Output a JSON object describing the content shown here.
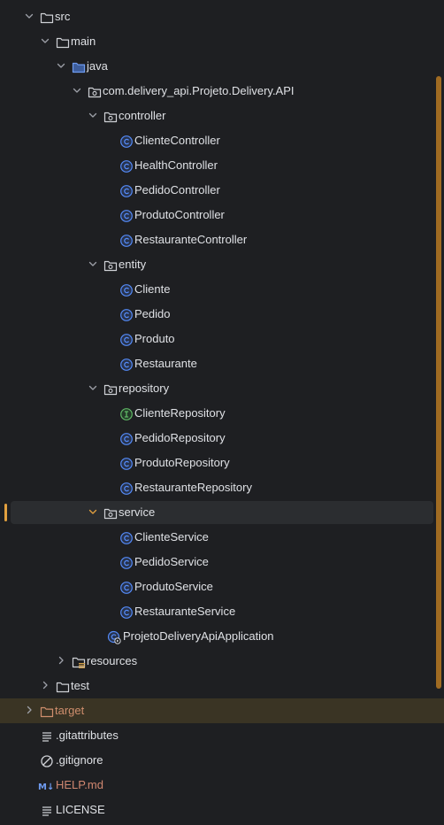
{
  "tree": [
    {
      "label": "src",
      "kind": "folder",
      "level": 0,
      "expanded": true,
      "name": "tree-node-src"
    },
    {
      "label": "main",
      "kind": "folder",
      "level": 1,
      "expanded": true,
      "name": "tree-node-main"
    },
    {
      "label": "java",
      "kind": "folder-source",
      "level": 2,
      "expanded": true,
      "name": "tree-node-java"
    },
    {
      "label": "com.delivery_api.Projeto.Delivery.API",
      "kind": "package",
      "level": 3,
      "expanded": true,
      "name": "tree-node-root-package"
    },
    {
      "label": "controller",
      "kind": "package",
      "level": 4,
      "expanded": true,
      "name": "tree-node-controller"
    },
    {
      "label": "ClienteController",
      "kind": "class",
      "level": 5,
      "name": "tree-node-clientecontroller"
    },
    {
      "label": "HealthController",
      "kind": "class",
      "level": 5,
      "name": "tree-node-healthcontroller"
    },
    {
      "label": "PedidoController",
      "kind": "class",
      "level": 5,
      "name": "tree-node-pedidocontroller"
    },
    {
      "label": "ProdutoController",
      "kind": "class",
      "level": 5,
      "name": "tree-node-produtocontroller"
    },
    {
      "label": "RestauranteController",
      "kind": "class",
      "level": 5,
      "name": "tree-node-restaurantecontroller"
    },
    {
      "label": "entity",
      "kind": "package",
      "level": 4,
      "expanded": true,
      "name": "tree-node-entity"
    },
    {
      "label": "Cliente",
      "kind": "class",
      "level": 5,
      "name": "tree-node-cliente"
    },
    {
      "label": "Pedido",
      "kind": "class",
      "level": 5,
      "name": "tree-node-pedido"
    },
    {
      "label": "Produto",
      "kind": "class",
      "level": 5,
      "name": "tree-node-produto"
    },
    {
      "label": "Restaurante",
      "kind": "class",
      "level": 5,
      "name": "tree-node-restaurante"
    },
    {
      "label": "repository",
      "kind": "package",
      "level": 4,
      "expanded": true,
      "name": "tree-node-repository"
    },
    {
      "label": "ClienteRepository",
      "kind": "interface",
      "level": 5,
      "name": "tree-node-clienterepository"
    },
    {
      "label": "PedidoRepository",
      "kind": "class",
      "level": 5,
      "name": "tree-node-pedidorepository"
    },
    {
      "label": "ProdutoRepository",
      "kind": "class",
      "level": 5,
      "name": "tree-node-produtorepository"
    },
    {
      "label": "RestauranteRepository",
      "kind": "class",
      "level": 5,
      "name": "tree-node-restauranterepository"
    },
    {
      "label": "service",
      "kind": "package",
      "level": 4,
      "expanded": true,
      "selected": true,
      "name": "tree-node-service"
    },
    {
      "label": "ClienteService",
      "kind": "class",
      "level": 5,
      "name": "tree-node-clienteservice"
    },
    {
      "label": "PedidoService",
      "kind": "class",
      "level": 5,
      "name": "tree-node-pedidoservice"
    },
    {
      "label": "ProdutoService",
      "kind": "class",
      "level": 5,
      "name": "tree-node-produtoservice"
    },
    {
      "label": "RestauranteService",
      "kind": "class",
      "level": 5,
      "name": "tree-node-restauranteservice"
    },
    {
      "label": "ProjetoDeliveryApiApplication",
      "kind": "app-class",
      "level": 4,
      "name": "tree-node-application"
    },
    {
      "label": "resources",
      "kind": "folder-resources",
      "level": 2,
      "expanded": false,
      "name": "tree-node-resources"
    },
    {
      "label": "test",
      "kind": "folder",
      "level": 1,
      "expanded": false,
      "name": "tree-node-test"
    },
    {
      "label": "target",
      "kind": "folder-excluded",
      "level": 0,
      "expanded": false,
      "excluded": true,
      "name": "tree-node-target"
    },
    {
      "label": ".gitattributes",
      "kind": "text-file",
      "level": 0,
      "leafRoot": true,
      "name": "tree-node-gitattributes"
    },
    {
      "label": ".gitignore",
      "kind": "ignore-file",
      "level": 0,
      "leafRoot": true,
      "name": "tree-node-gitignore"
    },
    {
      "label": "HELP.md",
      "kind": "markdown-file",
      "level": 0,
      "leafRoot": true,
      "name": "tree-node-help-md"
    },
    {
      "label": "LICENSE",
      "kind": "text-file",
      "level": 0,
      "leafRoot": true,
      "name": "tree-node-license"
    }
  ],
  "icons": {
    "folder": "folder-icon",
    "folder-source": "source-folder-icon",
    "folder-resources": "resources-folder-icon",
    "folder-excluded": "excluded-folder-icon",
    "package": "package-icon",
    "class": "class-icon",
    "interface": "interface-icon",
    "app-class": "application-class-icon",
    "text-file": "text-file-icon",
    "ignore-file": "ignore-file-icon",
    "markdown-file": "markdown-icon"
  },
  "icon_text": {
    "markdown": "M↓"
  },
  "colors": {
    "background": "#1e1f22",
    "text": "#dfe1e5",
    "excluded_text": "#cf8e6d",
    "markdown_text": "#d08770",
    "class_icon": "#548af7",
    "interface_icon": "#5fb865",
    "selected_row": "#2b2d30",
    "excluded_row": "#3a3424",
    "accent": "#e2a03f",
    "scrollbar": "#a06b22"
  }
}
